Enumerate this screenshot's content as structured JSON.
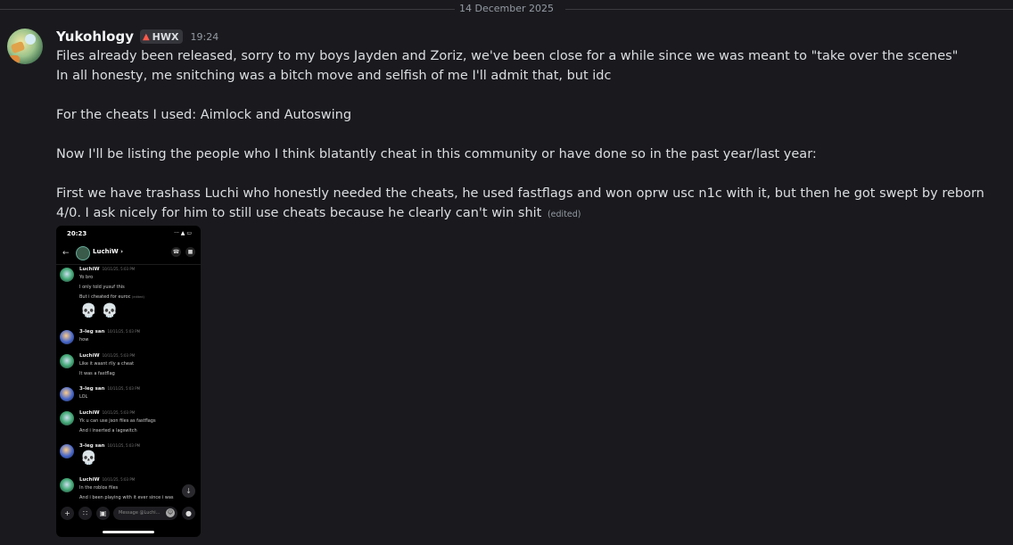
{
  "divider": {
    "date": "14 December 2025"
  },
  "message": {
    "username": "Yukohlogy",
    "tag_icon": "flame-icon",
    "tag": "HWX",
    "time": "19:24",
    "lines": [
      "Files already been released, sorry to my boys Jayden and Zoriz, we've been close for a while since we was meant to \"take over the scenes\"",
      "In all honesty, me snitching was a bitch move and selfish of me I'll admit that, but idc",
      "For the cheats I used: Aimlock and Autoswing",
      "Now I'll be listing the people who I think blatantly cheat in this community or have done so in the past year/last year:",
      "First we have trashass Luchi who honestly needed the cheats, he used fastflags and won oprw usc n1c with it, but then he got swept by reborn 4/0. I ask nicely for him to still use cheats because he clearly can't win shit"
    ],
    "edited": "(edited)"
  },
  "attachment": {
    "status_time": "20:23",
    "status_icons": "··· ▲ ▭",
    "chat_name": "LuchiW",
    "messages": [
      {
        "author": "LuchiW",
        "timestamp": "10/11/25, 5:03 PM",
        "lines": [
          "Yo bro",
          "I only told yusuf this",
          "But i cheated for euroc"
        ],
        "edited": "(edited)",
        "skulls": "💀 💀"
      },
      {
        "author": "3-leg san",
        "timestamp": "10/11/25, 5:03 PM",
        "lines": [
          "how"
        ]
      },
      {
        "author": "LuchiW",
        "timestamp": "10/11/25, 5:03 PM",
        "lines": [
          "Like it wasnt rlly a cheat",
          "It was a fastflag"
        ]
      },
      {
        "author": "3-leg san",
        "timestamp": "10/11/25, 5:03 PM",
        "lines": [
          "LOL"
        ]
      },
      {
        "author": "LuchiW",
        "timestamp": "10/11/25, 5:03 PM",
        "lines": [
          "Yk u can use json files as fastflags",
          "And i inserted a lagswitch"
        ]
      },
      {
        "author": "3-leg san",
        "timestamp": "10/11/25, 5:03 PM",
        "skull": "💀"
      },
      {
        "author": "LuchiW",
        "timestamp": "10/11/25, 5:03 PM",
        "lines": [
          "In the roblox files",
          "And i been playing with it ever since i was"
        ]
      }
    ],
    "input_placeholder": "Message @Luchi..."
  }
}
